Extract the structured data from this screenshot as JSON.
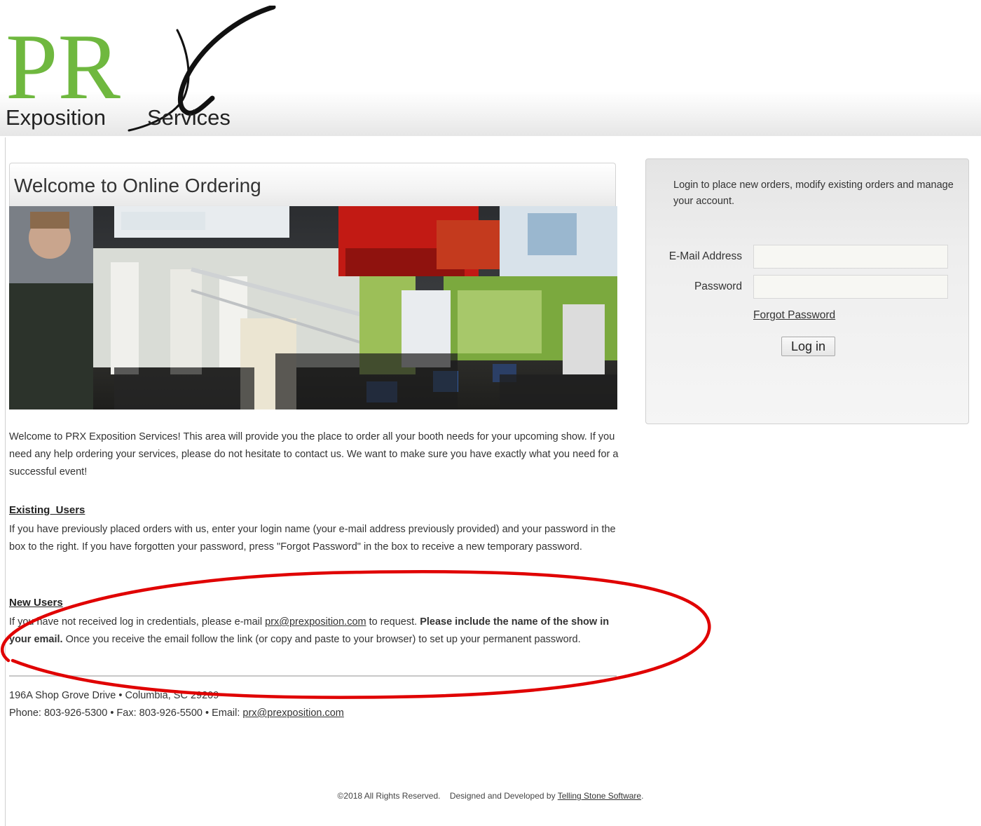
{
  "logo": {
    "letters": "PR",
    "subtitle_left": "Exposition",
    "subtitle_right": "Services",
    "brand_color": "#6fb83f"
  },
  "welcome": {
    "title": "Welcome to Online Ordering",
    "intro": "Welcome to PRX Exposition Services! This area will provide you the place to order all your booth needs for your upcoming show. If you need any help ordering your services, please do not hesitate to contact us. We want to make sure you have exactly what you need for a successful event!"
  },
  "existing_users": {
    "heading": "Existing  Users",
    "text": "If you have previously placed orders with us, enter your login name (your e-mail address previously provided) and your password in the box to the right. If you have forgotten your password, press \"Forgot Password\" in the box to receive a new temporary password."
  },
  "new_users": {
    "heading": "New Users",
    "text_before": "If you have not received log in credentials, please e-mail ",
    "email": "prx@prexposition.com",
    "text_middle": " to request. ",
    "bold": "Please include the name of the show in your email.",
    "text_after": " Once you receive the email follow the link (or copy and paste to your browser) to set up your permanent password."
  },
  "address": {
    "line1": "196A Shop Grove Drive • Columbia, SC 29209",
    "line2_prefix": "Phone: 803-926-5300 • Fax: 803-926-5500 • Email: ",
    "email": "prx@prexposition.com"
  },
  "login": {
    "intro": "Login to place new orders, modify existing orders and manage your account.",
    "email_label": "E-Mail Address",
    "email_value": "",
    "password_label": "Password",
    "password_value": "",
    "forgot_label": "Forgot Password",
    "button_label": "Log in"
  },
  "footer": {
    "copyright": "©2018 All Rights Reserved.",
    "designed_prefix": "Designed and Developed by ",
    "developer": "Telling Stone Software",
    "suffix": "."
  },
  "annotation": {
    "color": "#e00000"
  }
}
